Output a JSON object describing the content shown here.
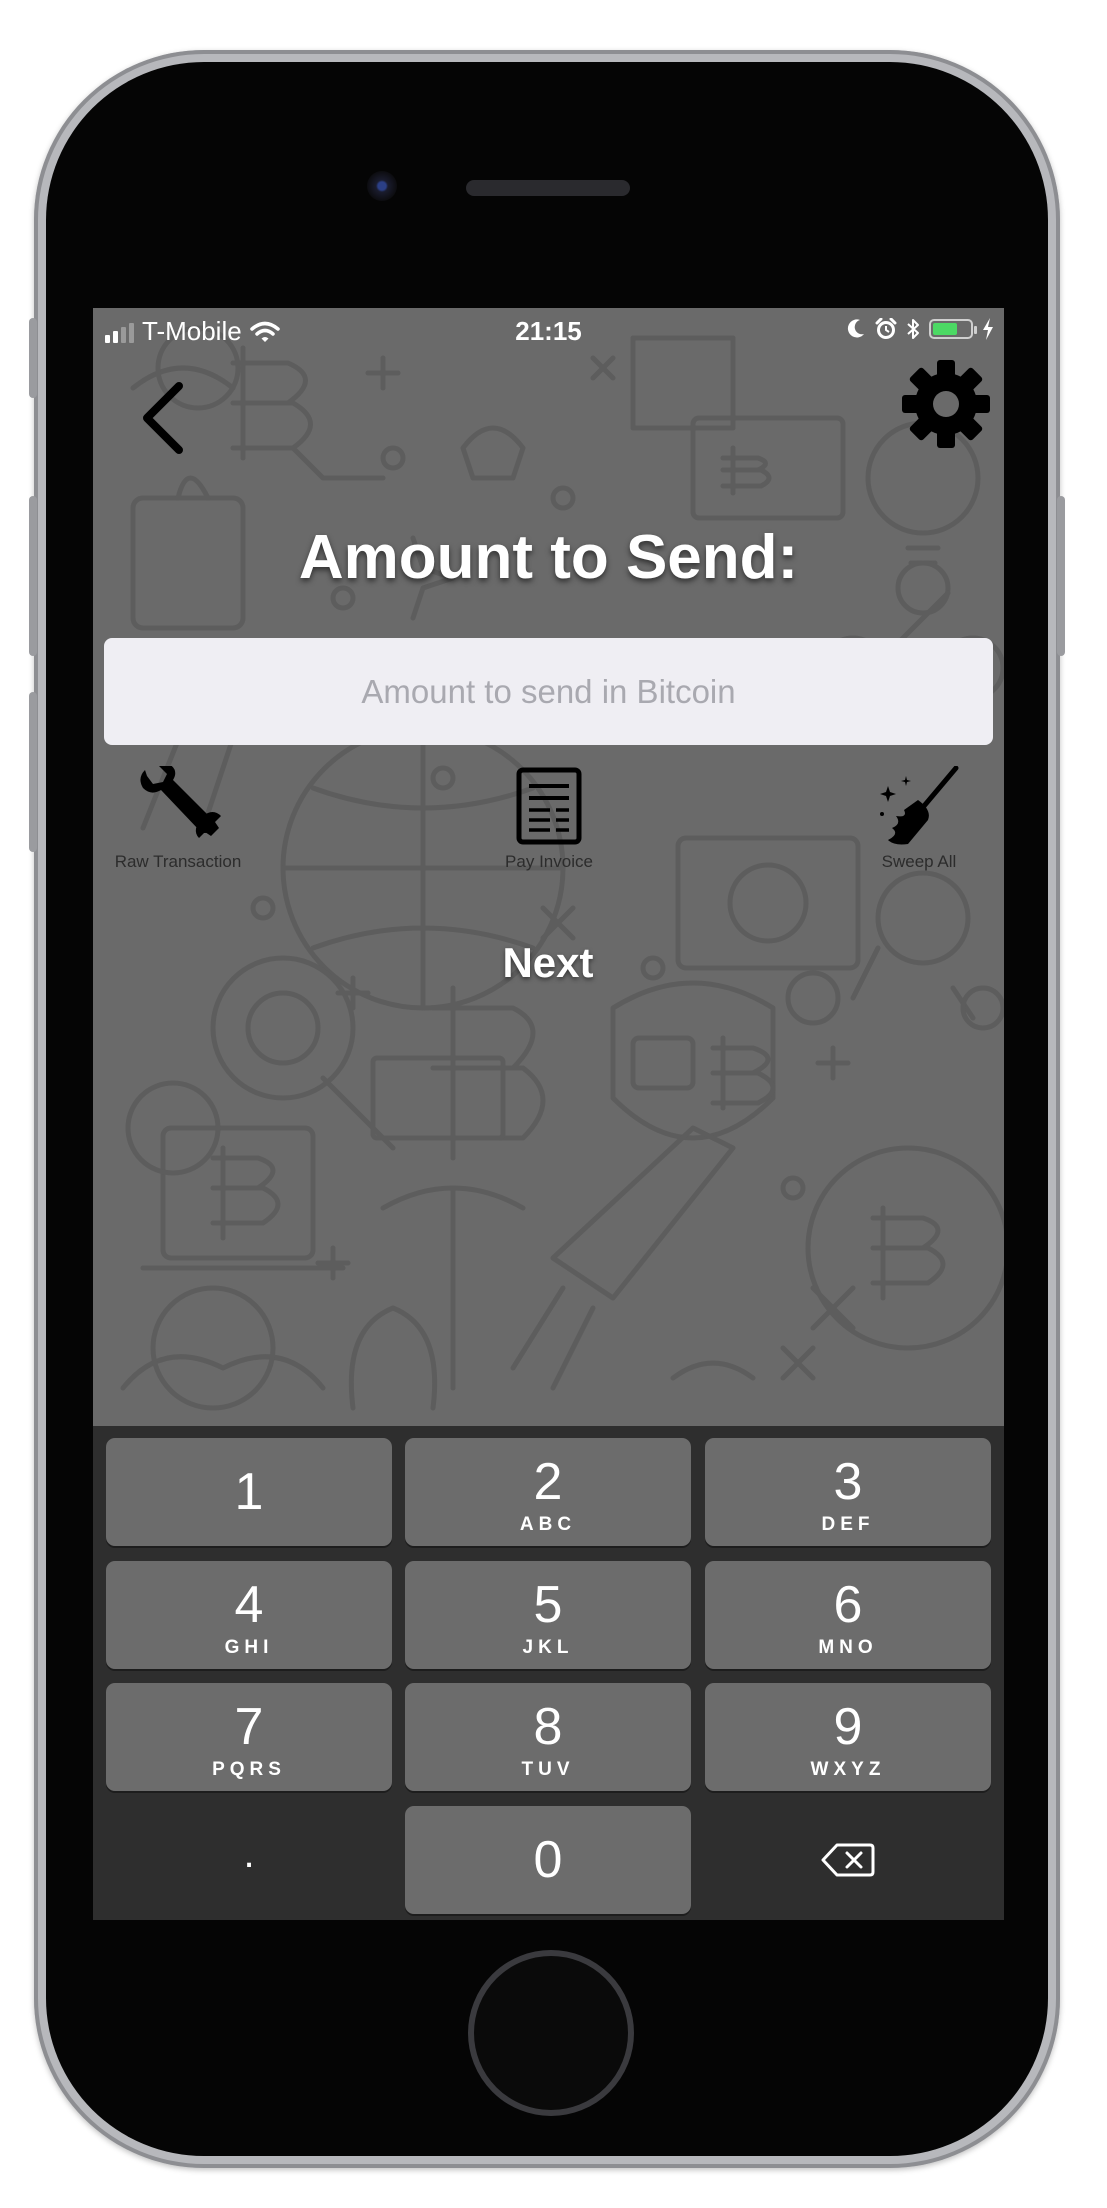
{
  "status_bar": {
    "carrier": "T-Mobile",
    "time": "21:15"
  },
  "header": {
    "back_icon": "chevron-left-icon",
    "settings_icon": "gear-icon"
  },
  "title": "Amount to Send:",
  "amount_input": {
    "placeholder": "Amount to send in Bitcoin",
    "value": ""
  },
  "actions": [
    {
      "label": "Raw Transaction",
      "icon": "wrench-icon"
    },
    {
      "label": "Pay Invoice",
      "icon": "invoice-icon"
    },
    {
      "label": "Sweep All",
      "icon": "broom-icon"
    }
  ],
  "next_label": "Next",
  "keypad": {
    "keys": [
      {
        "num": "1",
        "letters": ""
      },
      {
        "num": "2",
        "letters": "ABC"
      },
      {
        "num": "3",
        "letters": "DEF"
      },
      {
        "num": "4",
        "letters": "GHI"
      },
      {
        "num": "5",
        "letters": "JKL"
      },
      {
        "num": "6",
        "letters": "MNO"
      },
      {
        "num": "7",
        "letters": "PQRS"
      },
      {
        "num": "8",
        "letters": "TUV"
      },
      {
        "num": "9",
        "letters": "WXYZ"
      },
      {
        "num": "0",
        "letters": ""
      }
    ],
    "decimal": ".",
    "delete_icon": "backspace-icon"
  },
  "colors": {
    "screen_bg": "#6a6a6a",
    "keypad_bg": "#2e2e2e",
    "key_bg": "#6c6c6c",
    "battery": "#4cd964"
  }
}
